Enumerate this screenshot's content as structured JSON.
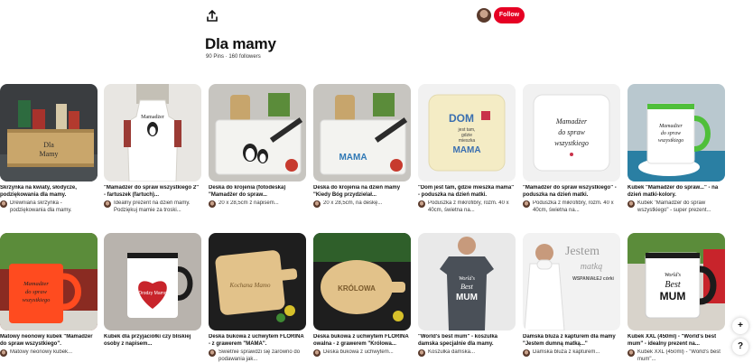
{
  "board": {
    "title": "Dla mamy",
    "meta": "90 Pins · 160 followers",
    "follow_label": "Follow"
  },
  "image_texts": {
    "pillow1": [
      "DOM",
      "jest tam,",
      "gdzie",
      "mieszka",
      "MAMA"
    ],
    "pillow2": [
      "Mamadżer",
      "do spraw",
      "wszystkiego"
    ],
    "mug_green": [
      "Mamadżer",
      "do spraw",
      "wszystkiego"
    ],
    "board_mama": "MAMA",
    "apron": "Mamadżer",
    "orange_mug": [
      "Mamadżer",
      "do spraw",
      "wszystkiego"
    ],
    "tshirt": [
      "World's",
      "Best",
      "MUM"
    ],
    "hoodie": [
      "Jestem",
      "matką",
      "WSPANIAŁEJ córki"
    ],
    "xxl_mug": [
      "World's",
      "Best",
      "MUM"
    ],
    "crate": [
      "Dla",
      "Mamy"
    ],
    "heart_mug": "Drodzy Mamo",
    "board_florina": "Kochana Mamo",
    "board_krolowa": "KRÓLOWA"
  },
  "pins": [
    {
      "title": "Skrzynka na kwiaty, słodycze, podziękowania dla mamy.",
      "desc": "Drewniana skrzynka - podziękowania dla mamy."
    },
    {
      "title": "\"Mamadżer do spraw wszystkiego 2\" - fartuszek (fartuch)...",
      "desc": "Idealny prezent na dzień mamy. Podziękuj mamie za troski..."
    },
    {
      "title": "Deska do krojenia (fotodeska) \"Mamadżer do spraw...",
      "desc": "20 x 28,5cm z napisem..."
    },
    {
      "title": "Deska do krojenia na dzień mamy \"Kiedy Bóg przydzielał...",
      "desc": "20 x 28,5cm, na deskę..."
    },
    {
      "title": "\"Dom jest tam, gdzie mieszka mama\" - poduszka na dzień matki.",
      "desc": "Poduszka z mikrofibry, rozm. 40 x 40cm, świetna na..."
    },
    {
      "title": "\"Mamadżer do spraw wszystkiego\" - poduszka na dzień matki.",
      "desc": "Poduszka z mikrofibry, rozm. 40 x 40cm, świetna na..."
    },
    {
      "title": "Kubek \"Mamadżer do spraw...\" - na dzień matki-kolory.",
      "desc": "Kubek \"Mamadżer do spraw wszystkiego\" - super prezent..."
    },
    {
      "title": "Matowy neonowy kubek \"Mamadżer do spraw wszystkiego\".",
      "desc": "Matowy neonowy kubek..."
    },
    {
      "title": "Kubek dla przyjaciółki czy bliskiej osoby z napisem...",
      "desc": ""
    },
    {
      "title": "Deska bukowa z uchwytem FLORINA - z grawerem \"MAMA\".",
      "desc": "Świetnie sprawdzi się zarówno do podawania jak..."
    },
    {
      "title": "Deska bukowa z uchwytem FLORINA owalna - z grawerem \"Królowa...",
      "desc": "Deska bukowa z uchwytem..."
    },
    {
      "title": "\"World's best mum\" - koszulka damska specjalnie dla mamy.",
      "desc": "Koszulka damska..."
    },
    {
      "title": "Damska bluza z kapturem dla mamy \"Jestem dumną matką...\"",
      "desc": "Damska bluza z kapturem..."
    },
    {
      "title": "Kubek XXL (450ml) - \"World's best mum\" - idealny prezent na...",
      "desc": "Kubek XXL (450ml) - \"World's best mum\"..."
    }
  ],
  "icons": {
    "share": "share-icon",
    "plus": "plus-icon",
    "help": "help-icon"
  },
  "colors": {
    "follow": "#e60023"
  }
}
